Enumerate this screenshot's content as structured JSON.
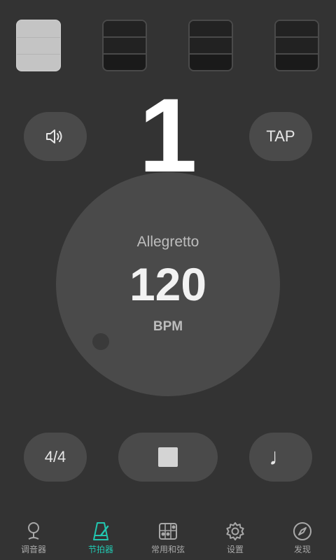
{
  "beats": [
    {
      "state": "active"
    },
    {
      "state": "idle"
    },
    {
      "state": "idle"
    },
    {
      "state": "idle"
    }
  ],
  "current_beat": "1",
  "sound_button": {
    "icon": "speaker-icon"
  },
  "tap_button": {
    "label": "TAP"
  },
  "dial": {
    "tempo_name": "Allegretto",
    "bpm": "120",
    "unit": "BPM"
  },
  "controls": {
    "time_signature": "4/4",
    "stop_icon": "stop-icon",
    "note_icon": "♩"
  },
  "colors": {
    "background": "#333333",
    "accent": "#22c7b0",
    "pill": "#4a4a4a"
  },
  "tabs": [
    {
      "label": "调音器",
      "icon": "tuner-pin-icon",
      "active": false
    },
    {
      "label": "节拍器",
      "icon": "metronome-icon",
      "active": true
    },
    {
      "label": "常用和弦",
      "icon": "chord-grid-icon",
      "active": false
    },
    {
      "label": "设置",
      "icon": "gear-icon",
      "active": false
    },
    {
      "label": "发现",
      "icon": "compass-icon",
      "active": false
    }
  ]
}
